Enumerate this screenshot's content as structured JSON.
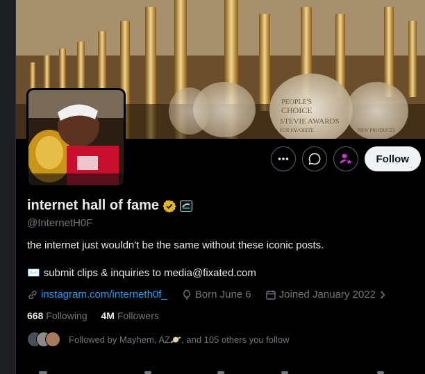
{
  "profile": {
    "display_name": "internet hall of fame",
    "handle": "@InternetH0F",
    "bio_line1": "the internet just wouldn't be the same without these iconic posts.",
    "bio_line2_emoji": "✉️",
    "bio_line2": "submit clips & inquiries to media@fixated.com",
    "website": "instagram.com/interneth0f_",
    "birthday": "Born June 6",
    "joined": "Joined January 2022",
    "following_count": "668",
    "following_label": "Following",
    "followers_count": "4M",
    "followers_label": "Followers",
    "followed_by": "Followed by Mayhem, AZ🪐, and 105 others you follow"
  },
  "actions": {
    "follow_label": "Follow",
    "more_icon": "more-horizontal-icon",
    "message_icon": "message-bubble-icon",
    "subscribe_icon": "person-star-icon"
  },
  "banner": {
    "trophy_text_1": "PEOPLE'S",
    "trophy_text_2": "CHOICE",
    "trophy_text_3": "STEVIE AWARDS",
    "trophy_text_4": "FOR FAVORITE",
    "trophy_text_5": "NEW PRODUCTS"
  },
  "colors": {
    "background": "#000000",
    "link": "#1d9bf0",
    "muted": "#71767b",
    "verified_gold": "#e2b719",
    "subscribe_accent": "#c936cc"
  }
}
